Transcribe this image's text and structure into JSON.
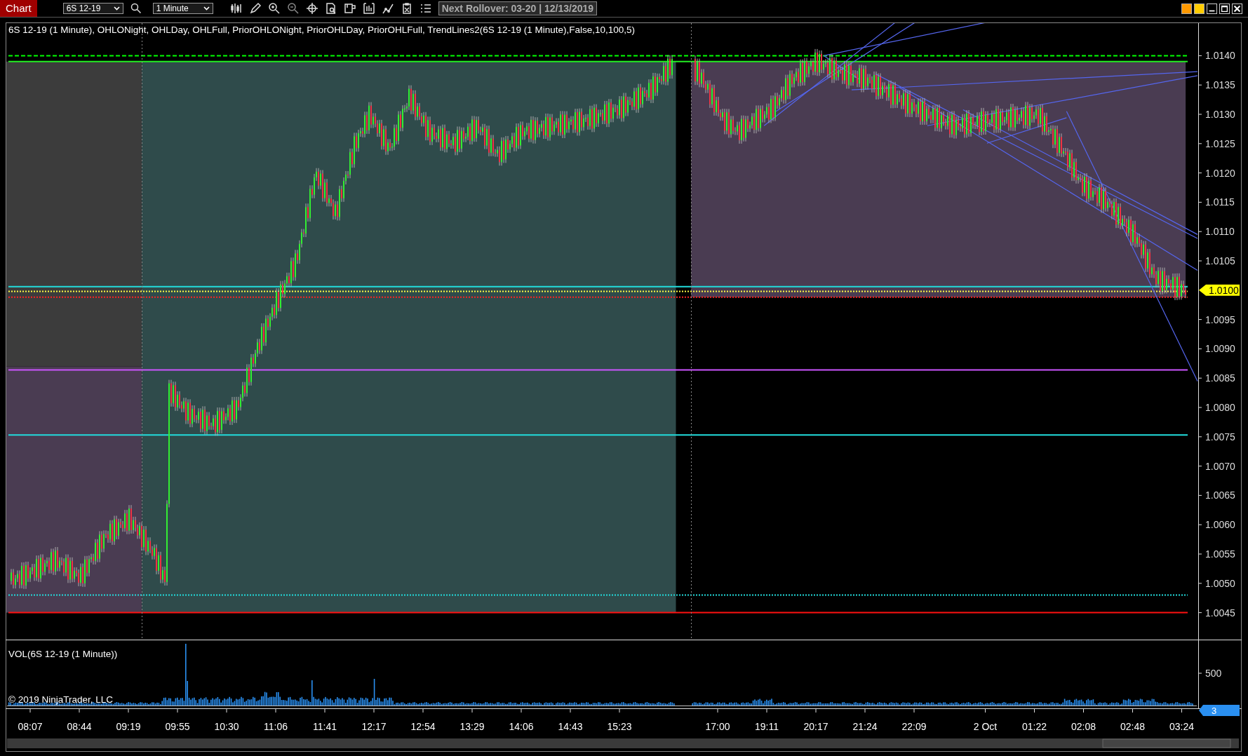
{
  "window": {
    "title": "Chart"
  },
  "toolbar": {
    "instrument": "6S 12-19",
    "interval": "1 Minute",
    "rollover": "Next Rollover: 03-20 | 12/13/2019"
  },
  "price_panel": {
    "title": "6S 12-19 (1 Minute), OHLONight, OHLDay, OHLFull, PriorOHLONight, PriorOHLDay, PriorOHLFull, TrendLines2(6S 12-19 (1 Minute),False,10,100,5)",
    "price_axis": [
      "1.0140",
      "1.0135",
      "1.0130",
      "1.0125",
      "1.0120",
      "1.0115",
      "1.0110",
      "1.0105",
      "1.0095",
      "1.0090",
      "1.0085",
      "1.0080",
      "1.0075",
      "1.0070",
      "1.0065",
      "1.0060",
      "1.0055",
      "1.0050",
      "1.0045"
    ],
    "current_price": "1.0100"
  },
  "volume_panel": {
    "title": "VOL(6S 12-19 (1 Minute))",
    "axis_label": "500",
    "current_volume": "3"
  },
  "copyright": "© 2019 NinjaTrader, LLC",
  "time_axis": [
    "08:07",
    "08:44",
    "09:19",
    "09:55",
    "10:30",
    "11:06",
    "11:41",
    "12:17",
    "12:54",
    "13:29",
    "14:06",
    "14:43",
    "15:23",
    "17:00",
    "19:11",
    "20:17",
    "21:24",
    "22:09",
    "2 Oct",
    "01:22",
    "02:08",
    "02:48",
    "03:24"
  ]
}
